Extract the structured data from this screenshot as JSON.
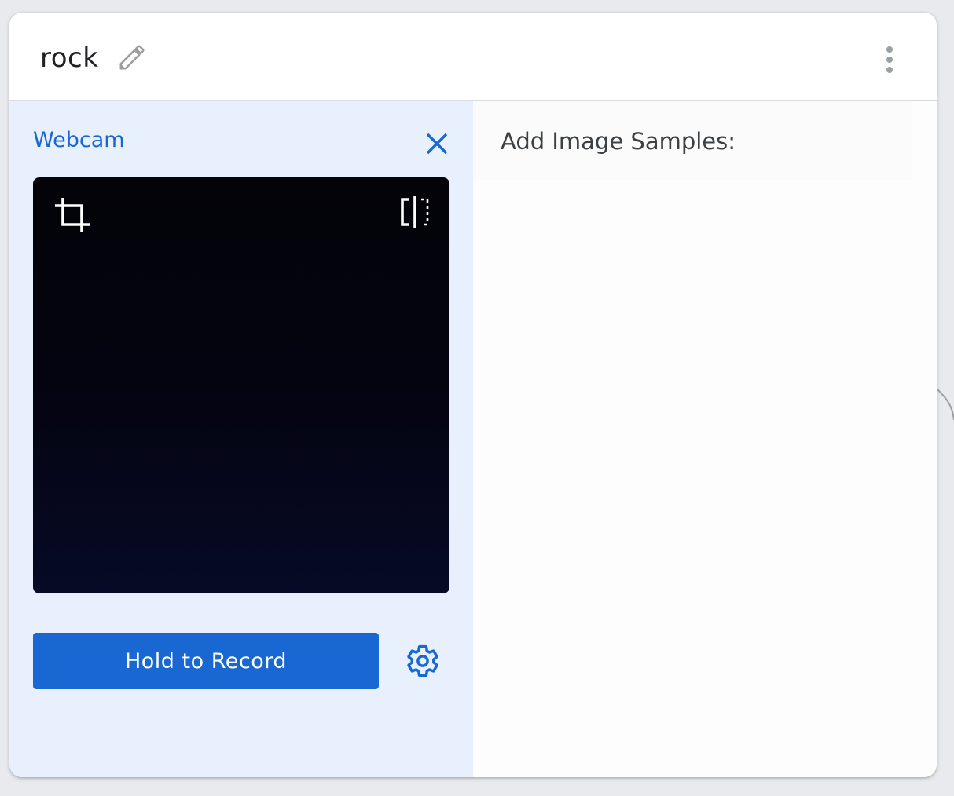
{
  "class_card": {
    "name": "rock",
    "edit_icon": "pencil-icon",
    "menu_icon": "more-vert-icon"
  },
  "webcam": {
    "title": "Webcam",
    "close_icon": "close-icon",
    "crop_icon": "crop-icon",
    "flip_icon": "flip-icon",
    "record_label": "Hold to Record",
    "settings_icon": "gear-icon"
  },
  "samples": {
    "title": "Add Image Samples:"
  },
  "colors": {
    "accent": "#1967d2",
    "panel_bg": "#e8f0fe",
    "page_bg": "#e8eaed",
    "text_primary": "#202124",
    "text_secondary": "#3c4043"
  }
}
